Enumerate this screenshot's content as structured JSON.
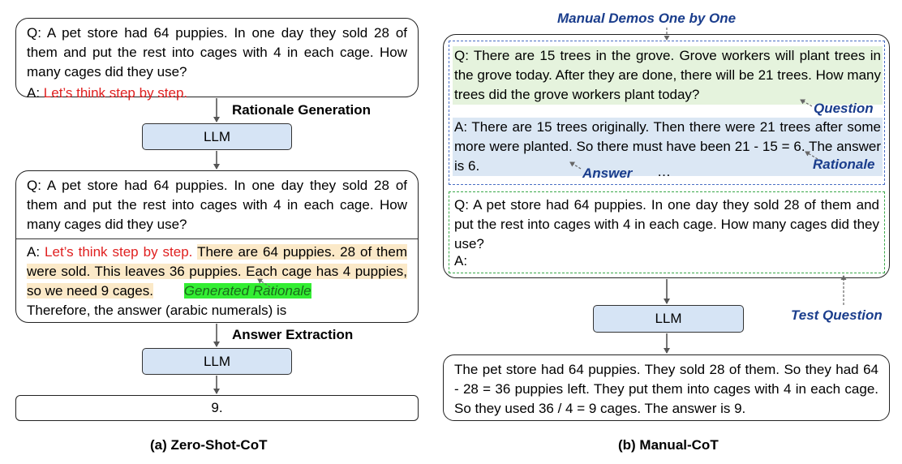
{
  "left": {
    "q1_question": "Q: A pet store had 64 puppies. In one day they sold 28 of them and put the rest into cages with 4 in each cage. How many cages did they use?",
    "q1_answer_prefix": "A: ",
    "trigger": "Let’s think step by step.",
    "rationale_generation_label": "Rationale Generation",
    "llm_label": "LLM",
    "q2_question": "Q: A pet store had 64 puppies. In one day they sold 28 of them and put the rest into cages with 4 in each cage. How many cages did they use?",
    "q2_answer_prefix": "A: ",
    "q2_rationale": "There are 64 puppies. 28 of them were sold. This leaves 36 puppies. Each cage has 4 puppies, so we need 9 cages.",
    "generated_rationale_label": "Generated Rationale",
    "q2_extraction_prompt": "Therefore, the answer (arabic numerals) is",
    "answer_extraction_label": "Answer Extraction",
    "final_answer": "9.",
    "caption": "(a) Zero-Shot-CoT"
  },
  "right": {
    "manual_demos_label": "Manual Demos One by One",
    "demo_question": "Q: There are 15 trees in the grove. Grove workers will plant trees in the grove today. After they are done, there will be 21 trees. How many trees did the grove workers plant today?",
    "question_label": "Question",
    "demo_answer": "A: There are 15 trees originally. Then there were 21 trees after some more were planted. So there must have been 21 - 15 = 6. The answer is 6.",
    "answer_label": "Answer",
    "ellipsis": "…",
    "rationale_label": "Rationale",
    "test_question": "Q: A pet store had 64 puppies. In one day they sold 28 of them and put the rest into cages with 4 in each cage. How many cages did they use?",
    "test_answer_prefix": "A:",
    "test_question_label": "Test Question",
    "llm_label": "LLM",
    "output": "The pet store had 64 puppies. They sold 28 of them. So they had 64 - 28 = 36 puppies left. They put them into cages with 4 in each cage. So they used 36 / 4 = 9 cages. The answer is 9.",
    "caption": "(b) Manual-CoT"
  },
  "colors": {
    "trigger_red": "#e02020",
    "rationale_yellow": "#fbe9c8",
    "generated_label_green": "#33ee33",
    "demo_question_green": "#e5f3dd",
    "demo_answer_blue": "#dbe7f4",
    "llm_fill": "#d6e4f5",
    "label_blue": "#1a3d8c",
    "demo_border_blue": "#4a6fc4",
    "test_border_green": "#3aa84a"
  }
}
